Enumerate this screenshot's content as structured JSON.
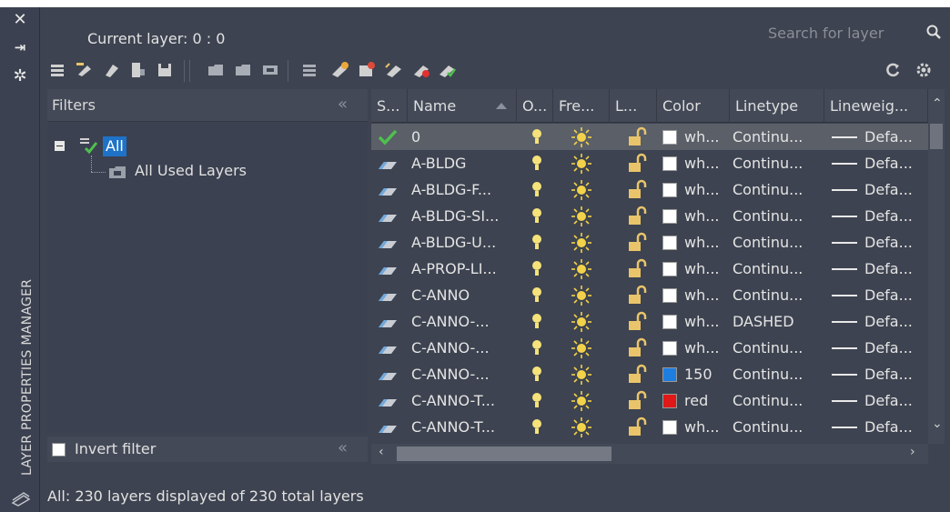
{
  "palette_title": "LAYER PROPERTIES MANAGER",
  "current_layer_label": "Current layer: 0 : 0",
  "search": {
    "placeholder": "Search for layer"
  },
  "filters": {
    "title": "Filters",
    "collapse_glyph": "«",
    "tree": {
      "root": "All",
      "child": "All Used Layers"
    },
    "invert_label": "Invert filter"
  },
  "columns": {
    "status": "S...",
    "name": "Name",
    "on": "O...",
    "freeze": "Fre...",
    "lock": "L...",
    "color": "Color",
    "linetype": "Linetype",
    "lineweight": "Lineweig..."
  },
  "layers": [
    {
      "name": "0",
      "color": "wh...",
      "swatch": "#ffffff",
      "linetype": "Continu...",
      "lineweight": "Defa...",
      "current": true
    },
    {
      "name": "A-BLDG",
      "color": "wh...",
      "swatch": "#ffffff",
      "linetype": "Continu...",
      "lineweight": "Defa...",
      "current": false
    },
    {
      "name": "A-BLDG-F...",
      "color": "wh...",
      "swatch": "#ffffff",
      "linetype": "Continu...",
      "lineweight": "Defa...",
      "current": false
    },
    {
      "name": "A-BLDG-SI...",
      "color": "wh...",
      "swatch": "#ffffff",
      "linetype": "Continu...",
      "lineweight": "Defa...",
      "current": false
    },
    {
      "name": "A-BLDG-U...",
      "color": "wh...",
      "swatch": "#ffffff",
      "linetype": "Continu...",
      "lineweight": "Defa...",
      "current": false
    },
    {
      "name": "A-PROP-LI...",
      "color": "wh...",
      "swatch": "#ffffff",
      "linetype": "Continu...",
      "lineweight": "Defa...",
      "current": false
    },
    {
      "name": "C-ANNO",
      "color": "wh...",
      "swatch": "#ffffff",
      "linetype": "Continu...",
      "lineweight": "Defa...",
      "current": false
    },
    {
      "name": "C-ANNO-...",
      "color": "wh...",
      "swatch": "#ffffff",
      "linetype": "DASHED",
      "lineweight": "Defa...",
      "current": false
    },
    {
      "name": "C-ANNO-...",
      "color": "wh...",
      "swatch": "#ffffff",
      "linetype": "Continu...",
      "lineweight": "Defa...",
      "current": false
    },
    {
      "name": "C-ANNO-...",
      "color": "150",
      "swatch": "#1e7ee0",
      "linetype": "Continu...",
      "lineweight": "Defa...",
      "current": false
    },
    {
      "name": "C-ANNO-T...",
      "color": "red",
      "swatch": "#e01818",
      "linetype": "Continu...",
      "lineweight": "Defa...",
      "current": false
    },
    {
      "name": "C-ANNO-T...",
      "color": "wh...",
      "swatch": "#ffffff",
      "linetype": "Continu...",
      "lineweight": "Defa...",
      "current": false
    }
  ],
  "status_bar": "All: 230 layers displayed of 230 total layers",
  "colors": {
    "panel_bg": "#3d4350",
    "selection": "#5a5f68",
    "tree_highlight": "#1e73c8",
    "bulb": "#f5e27a",
    "sun": "#f2d24a",
    "lock": "#e9c46a"
  }
}
